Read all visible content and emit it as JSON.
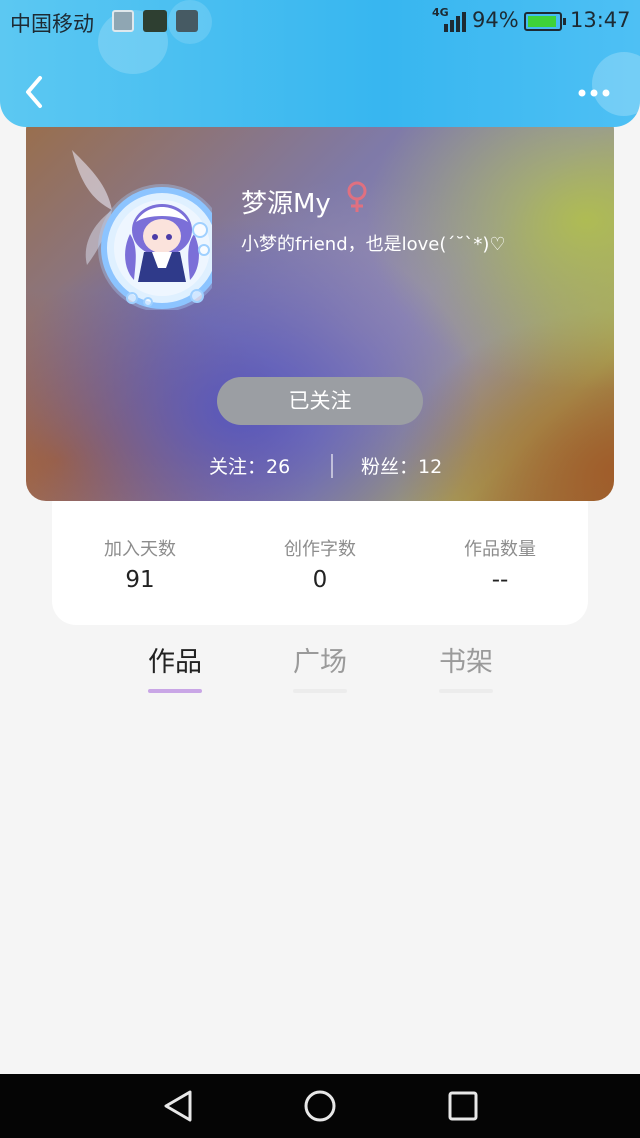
{
  "status_bar": {
    "carrier": "中国移动",
    "network": "4G",
    "battery_percent": "94%",
    "time": "13:47",
    "battery_level": 0.94
  },
  "nav": {
    "back_icon": "chevron-left-icon",
    "more_icon": "more-horizontal-icon"
  },
  "profile": {
    "username": "梦源My",
    "gender_icon": "female-icon",
    "bio": "小梦的friend，也是love(´˘`*)♡",
    "follow_button": "已关注",
    "following": "关注：26",
    "followers": "粉丝：12"
  },
  "stats": [
    {
      "label": "加入天数",
      "value": "91"
    },
    {
      "label": "创作字数",
      "value": "0"
    },
    {
      "label": "作品数量",
      "value": "--"
    }
  ],
  "tabs": [
    {
      "label": "作品",
      "active": true
    },
    {
      "label": "广场",
      "active": false
    },
    {
      "label": "书架",
      "active": false
    }
  ],
  "colors": {
    "header": "#37b6f0",
    "tab_active_underline": "#c9a6e6",
    "follow_button_bg": "#9b9ea3",
    "gender_icon": "#e07080"
  }
}
